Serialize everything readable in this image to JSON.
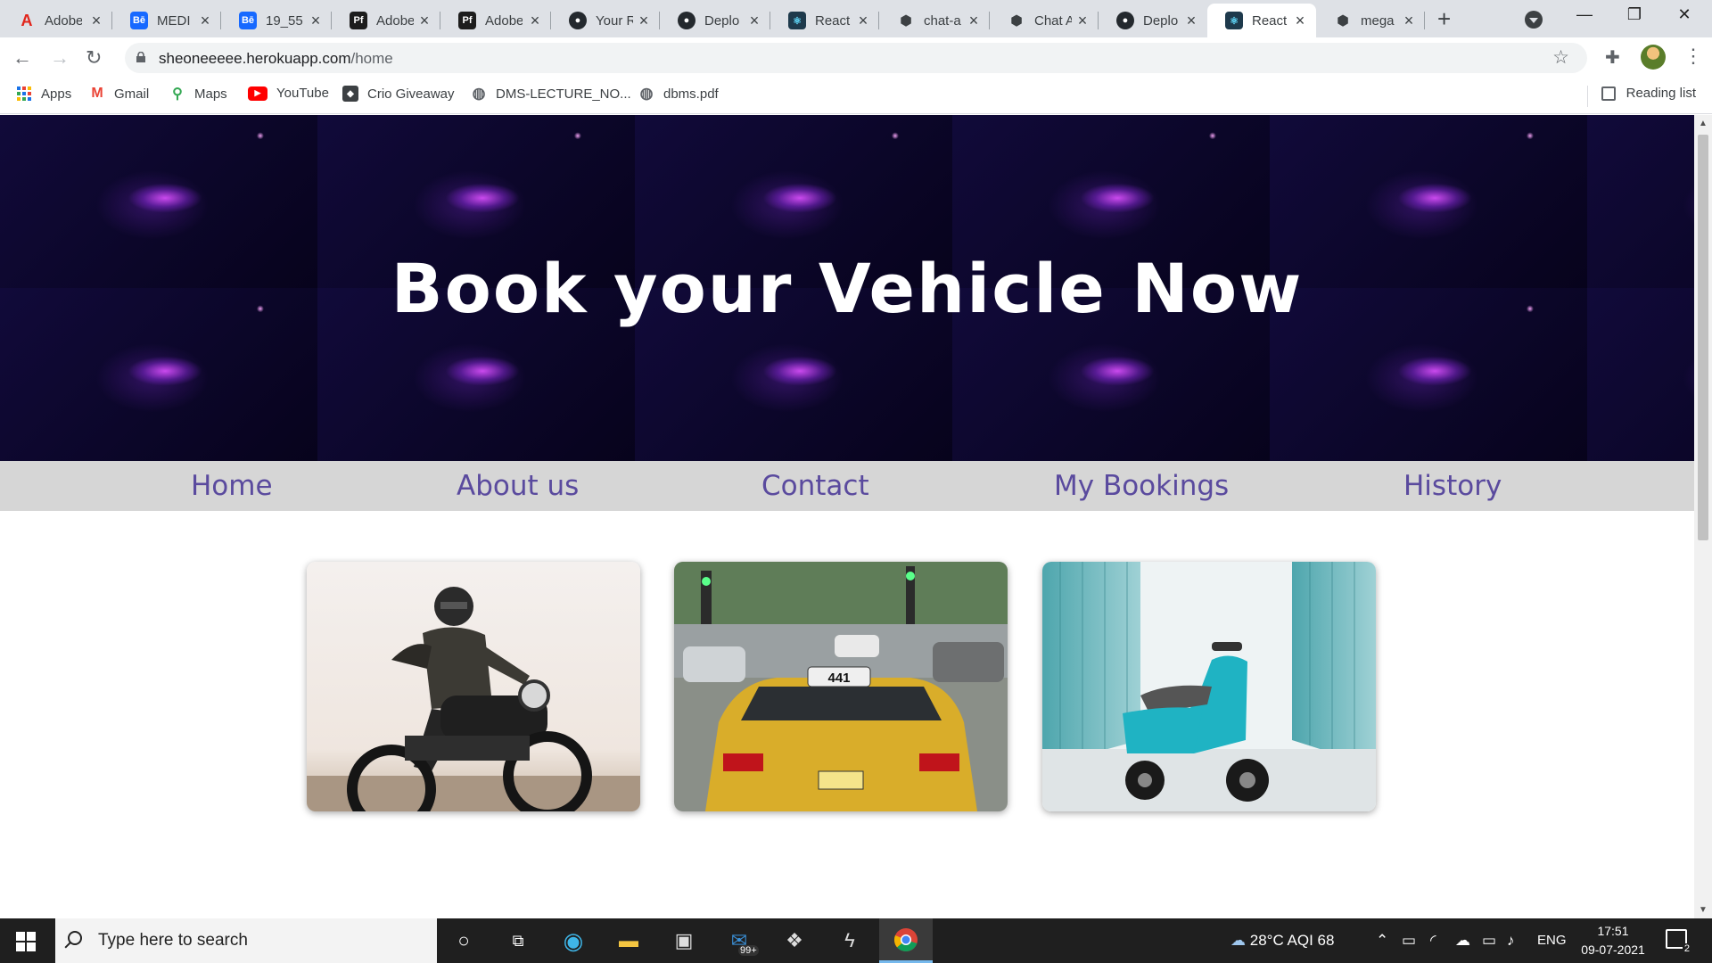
{
  "tabs": [
    {
      "title": "Adobe",
      "icon": "adobe-icon",
      "color": "#e1251b"
    },
    {
      "title": "MEDI",
      "icon": "behance-icon",
      "color": "#1769ff"
    },
    {
      "title": "19_55",
      "icon": "behance-icon",
      "color": "#1769ff"
    },
    {
      "title": "Adobe",
      "icon": "adobe-portfolio-icon",
      "color": "#1d1d1d"
    },
    {
      "title": "Adobe",
      "icon": "adobe-portfolio-icon",
      "color": "#1d1d1d"
    },
    {
      "title": "Your R",
      "icon": "github-icon",
      "color": "#24292e"
    },
    {
      "title": "Deplo",
      "icon": "github-icon",
      "color": "#24292e"
    },
    {
      "title": "React",
      "icon": "react-icon",
      "color": "#1e3a4c"
    },
    {
      "title": "chat-a",
      "icon": "box-icon",
      "color": "#3c4043"
    },
    {
      "title": "Chat A",
      "icon": "box-icon",
      "color": "#3c4043"
    },
    {
      "title": "Deplo",
      "icon": "github-icon",
      "color": "#24292e"
    },
    {
      "title": "React",
      "icon": "react-icon",
      "color": "#1e3a4c",
      "active": true
    },
    {
      "title": "mega",
      "icon": "box-icon",
      "color": "#3c4043"
    }
  ],
  "address": {
    "host": "sheoneeeee.herokuapp.com",
    "path": "/home"
  },
  "bookmarks": [
    {
      "label": "Apps",
      "icon": "apps-grid-icon"
    },
    {
      "label": "Gmail",
      "icon": "gmail-icon"
    },
    {
      "label": "Maps",
      "icon": "maps-icon"
    },
    {
      "label": "YouTube",
      "icon": "youtube-icon"
    },
    {
      "label": "Crio Giveaway",
      "icon": "crio-icon"
    },
    {
      "label": "DMS-LECTURE_NO...",
      "icon": "globe-icon"
    },
    {
      "label": "dbms.pdf",
      "icon": "globe-icon"
    }
  ],
  "reading_list": "Reading list",
  "page": {
    "hero_title": "Book your Vehicle Now",
    "nav": [
      "Home",
      "About us",
      "Contact",
      "My Bookings",
      "History"
    ],
    "cards": [
      {
        "image": "motorcycle-rider-image"
      },
      {
        "image": "yellow-taxi-image",
        "plate": "441"
      },
      {
        "image": "teal-scooter-image"
      }
    ],
    "colors": {
      "hero_bg": "#0b0629",
      "nav_bg": "#d6d6d6",
      "nav_text": "#5a4a9e"
    }
  },
  "taskbar": {
    "search_placeholder": "Type here to search",
    "weather": "28°C AQI 68",
    "language": "ENG",
    "time": "17:51",
    "date": "09-07-2021",
    "mail_badge": "99+",
    "notifications": "2"
  }
}
